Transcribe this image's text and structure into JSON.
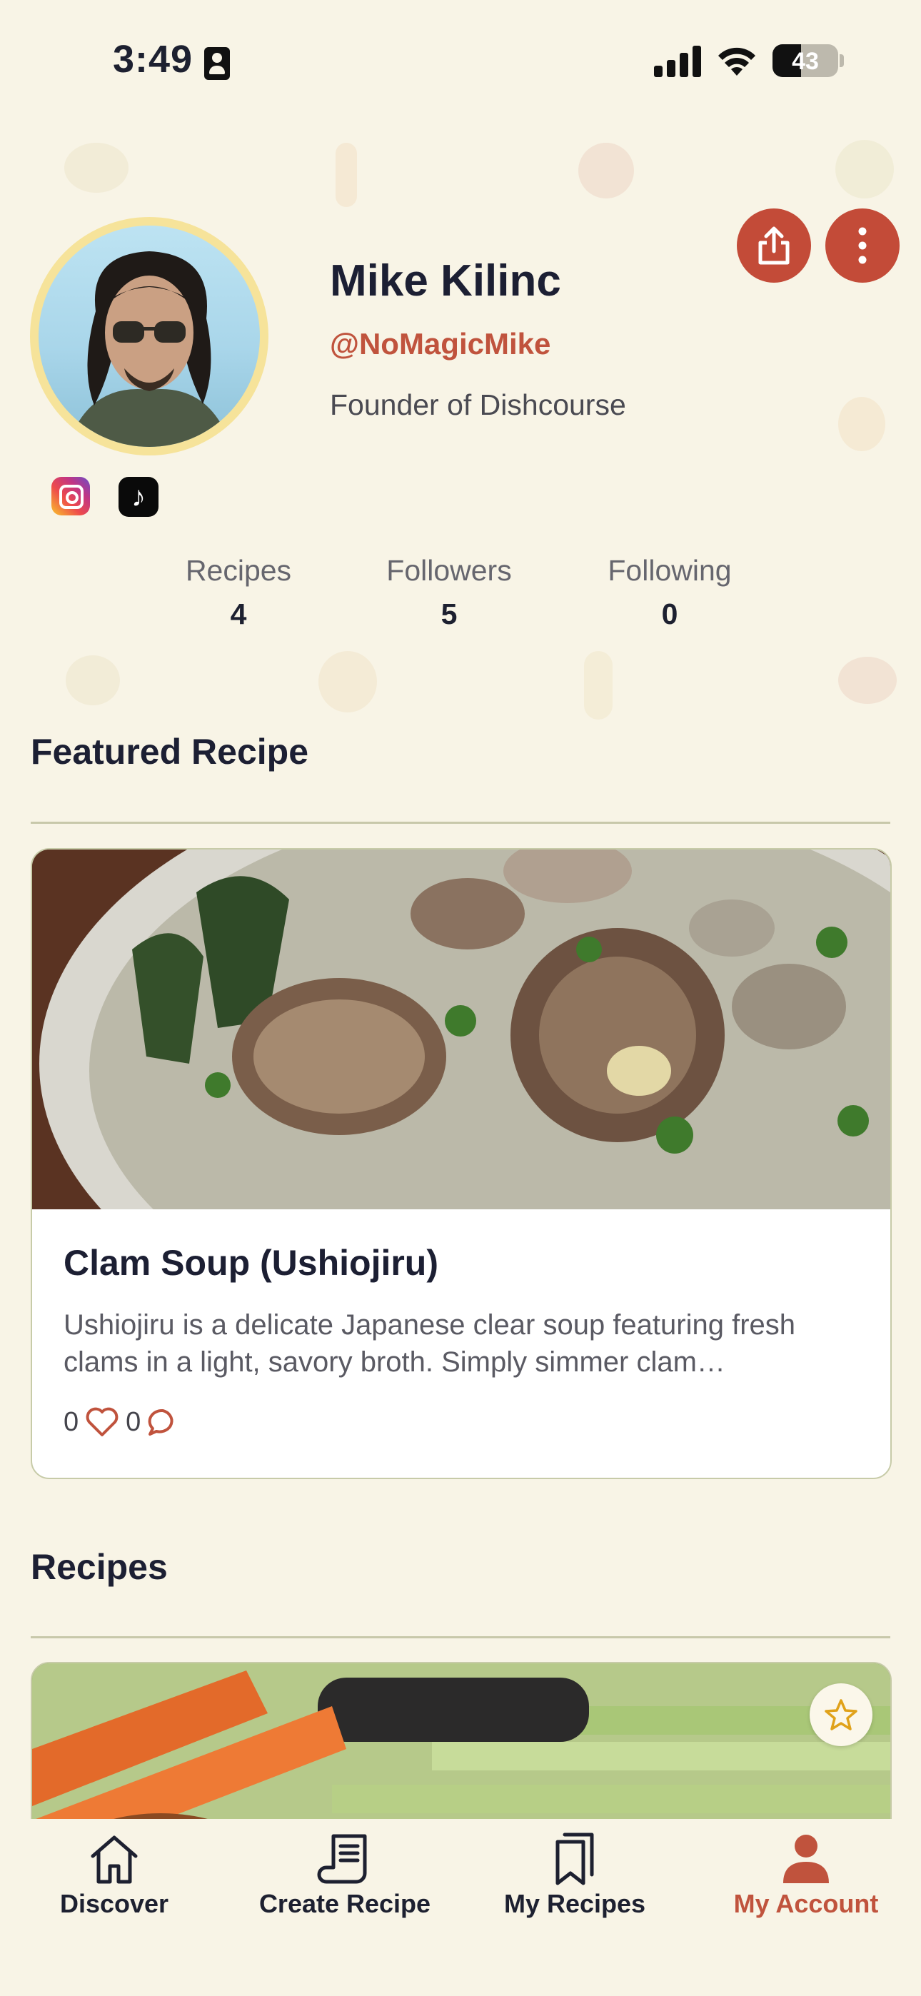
{
  "status_bar": {
    "time": "3:49",
    "battery": "43"
  },
  "profile": {
    "name": "Mike Kilinc",
    "handle": "@NoMagicMike",
    "bio": "Founder of Dishcourse",
    "stats": [
      {
        "label": "Recipes",
        "value": "4"
      },
      {
        "label": "Followers",
        "value": "5"
      },
      {
        "label": "Following",
        "value": "0"
      }
    ]
  },
  "featured": {
    "heading": "Featured Recipe",
    "title": "Clam Soup (Ushiojiru)",
    "description": "Ushiojiru is a delicate Japanese clear soup featuring fresh clams in a light, savory broth. Simply simmer clam…",
    "likes": "0",
    "comments": "0"
  },
  "recipes": {
    "heading": "Recipes"
  },
  "tabs": [
    {
      "label": "Discover",
      "icon": "home-icon"
    },
    {
      "label": "Create Recipe",
      "icon": "scroll-icon"
    },
    {
      "label": "My Recipes",
      "icon": "bookmarks-icon"
    },
    {
      "label": "My Account",
      "icon": "user-icon",
      "active": true
    }
  ],
  "colors": {
    "accent": "#c0533d",
    "background": "#f8f4e6",
    "avatar_ring": "#f6e39a"
  }
}
